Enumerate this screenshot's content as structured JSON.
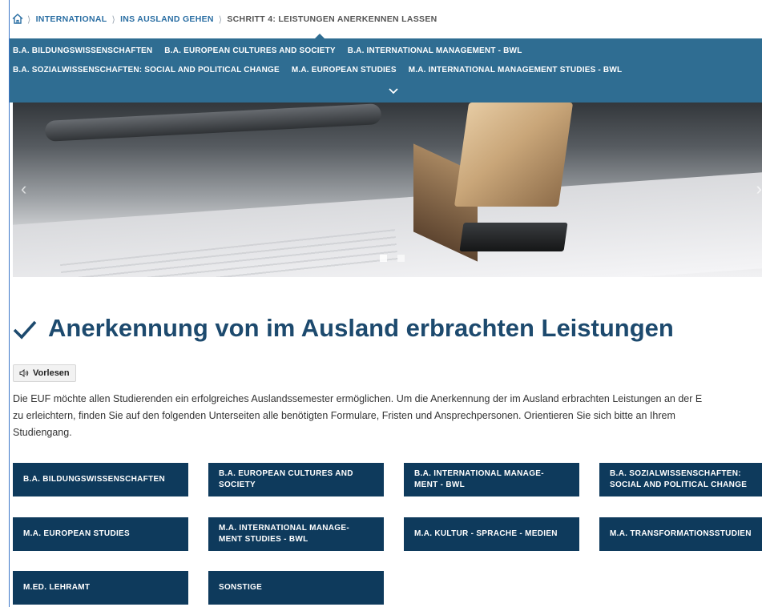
{
  "breadcrumb": {
    "home_icon": "home-icon",
    "items": [
      "INTERNATIONAL",
      "INS AUSLAND GEHEN",
      "SCHRITT 4: LEISTUNGEN ANERKENNEN LASSEN"
    ]
  },
  "subnav": {
    "row1": [
      "B.A. BILDUNGSWISSENSCHAFTEN",
      "B.A. EUROPEAN CULTURES AND SOCIETY",
      "B.A. INTERNATIONAL MANAGEMENT - BWL"
    ],
    "row2": [
      "B.A. SOZIALWISSENSCHAFTEN: SOCIAL AND POLITICAL CHANGE",
      "M.A. EUROPEAN STUDIES",
      "M.A. INTERNATIONAL MANAGEMENT STUDIES - BWL"
    ],
    "expand_icon": "chevron-down-icon",
    "background": "#2f6d92"
  },
  "hero": {
    "slide_count": 2,
    "active_slide": 1,
    "prev_icon": "chevron-left-icon",
    "next_icon": "chevron-right-icon",
    "prev_glyph": "‹",
    "next_glyph": "›"
  },
  "page": {
    "title": "Anerkennung von im Ausland erbrachten Leistungen",
    "title_icon": "checkmark-icon",
    "title_color": "#1d4a6e",
    "read_label": "Vorlesen",
    "intro_lines": [
      "Die EUF möchte allen Studierenden ein erfolgreiches Auslandssemester ermöglichen. Um die Anerkennung der im Ausland erbrachten Leistungen an der E",
      "zu erleichtern, finden Sie auf den folgenden Unterseiten alle benötigten Formulare, Fristen und Ansprechpersonen. Orientieren Sie sich bitte an Ihrem",
      "Studiengang."
    ]
  },
  "tiles": {
    "background": "#0e3a5c",
    "t1": "B.A. BILDUNGSWISSENSCHAFTEN",
    "t2a": "B.A. EUROPEAN CULTURES AND",
    "t2b": "SOCIETY",
    "t3a": "B.A. INTERNATIONAL MANAGE-",
    "t3b": "MENT - BWL",
    "t4a": "B.A. SOZIALWISSENSCHAFTEN:",
    "t4b": "SOCIAL AND POLITICAL CHANGE",
    "t5": "M.A. EUROPEAN STUDIES",
    "t6a": "M.A. INTERNATIONAL MANAGE-",
    "t6b": "MENT STUDIES - BWL",
    "t7": "M.A. KULTUR - SPRACHE - MEDIEN",
    "t8": "M.A. TRANSFORMATIONSSTUDIEN",
    "t9": "M.ED. LEHRAMT",
    "t10": "SONSTIGE"
  }
}
